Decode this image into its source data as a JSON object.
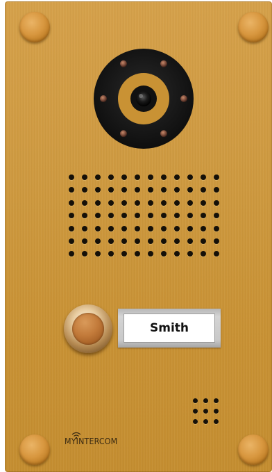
{
  "device": {
    "type": "video door intercom",
    "finish_color": "#cf9a40",
    "name_tag": "Smith",
    "brand_logo": "MYINTERCOM"
  },
  "icons": {
    "camera": "camera-lens-icon",
    "speaker": "speaker-grille-icon",
    "microphone": "microphone-holes-icon",
    "bell": "doorbell-button-icon",
    "wifi": "wifi-signal-icon"
  }
}
